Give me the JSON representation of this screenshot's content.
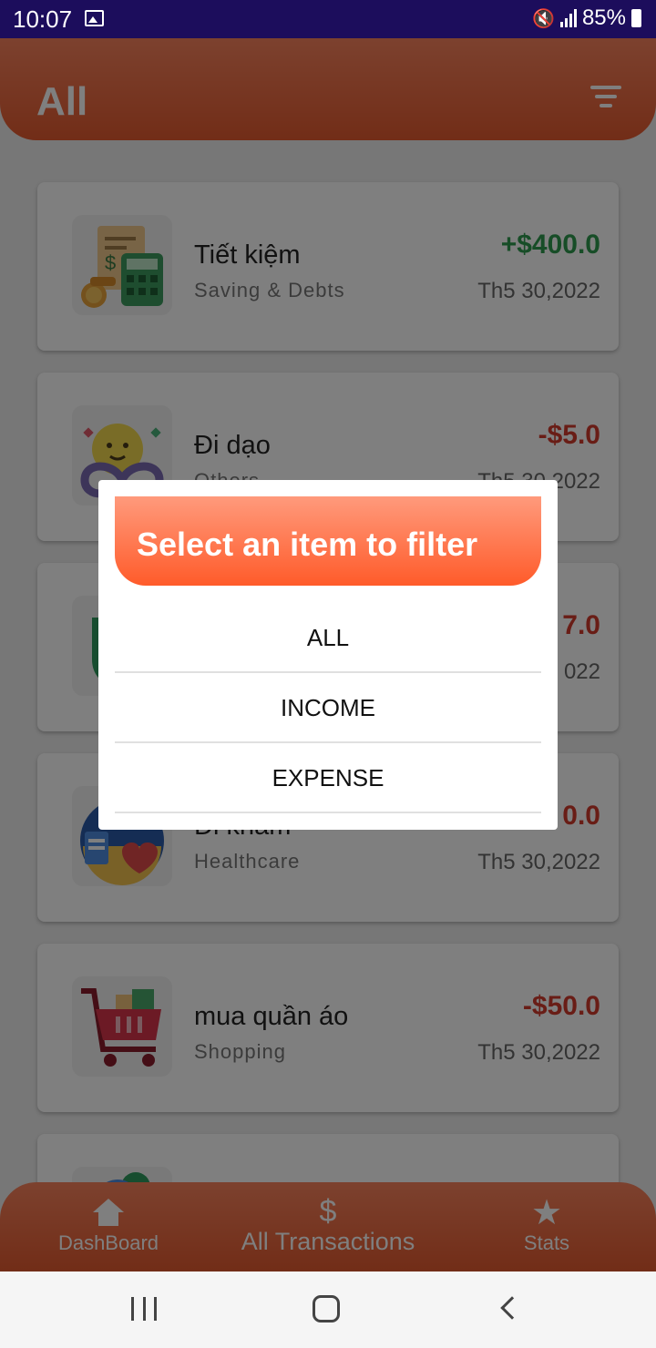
{
  "status_bar": {
    "time": "10:07",
    "battery": "85%"
  },
  "app_bar": {
    "title": "All",
    "filter_icon": "filter-list-icon"
  },
  "transactions": [
    {
      "name": "Tiết kiệm",
      "category": "Saving & Debts",
      "amount": "+$400.0",
      "date": "Th5 30,2022",
      "type": "income",
      "icon": "savings-calculator-icon"
    },
    {
      "name": "Đi dạo",
      "category": "Others",
      "amount": "-$5.0",
      "date": "Th5 30,2022",
      "type": "expense",
      "icon": "infinity-smiley-icon"
    },
    {
      "name": "",
      "category": "",
      "amount": "7.0",
      "date": "022",
      "type": "expense",
      "icon": "shield-icon"
    },
    {
      "name": "Đi khám",
      "category": "Healthcare",
      "amount": "0.0",
      "date": "Th5 30,2022",
      "type": "expense",
      "icon": "healthcare-icon"
    },
    {
      "name": "mua quần áo",
      "category": "Shopping",
      "amount": "-$50.0",
      "date": "Th5 30,2022",
      "type": "expense",
      "icon": "shopping-cart-icon"
    }
  ],
  "dialog": {
    "title": "Select an item to filter",
    "options": [
      "ALL",
      "INCOME",
      "EXPENSE"
    ]
  },
  "bottom_nav": {
    "dashboard": "DashBoard",
    "transactions": "All Transactions",
    "stats": "Stats"
  },
  "colors": {
    "accent": "#e45a2f",
    "income": "#2e9a4f",
    "expense": "#d23a2c",
    "status_bar": "#1c0d5c"
  }
}
